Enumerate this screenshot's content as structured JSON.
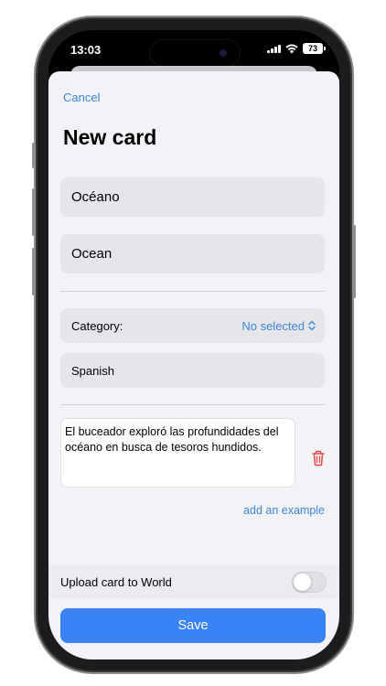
{
  "status_bar": {
    "time": "13:03",
    "battery": "73",
    "icons": [
      "cellular-signal-icon",
      "wifi-icon",
      "battery-icon"
    ]
  },
  "sheet": {
    "cancel_label": "Cancel",
    "title": "New card",
    "word_value": "Océano",
    "translation_value": "Ocean",
    "category_label": "Category:",
    "category_value": "No selected",
    "language_value": "Spanish",
    "example_text": "El buceador exploró las profundidades del océano en busca de tesoros hundidos.",
    "add_example_label": "add an example",
    "upload_label": "Upload card to World",
    "upload_enabled": false,
    "save_label": "Save"
  },
  "colors": {
    "accent": "#3a87d8",
    "save_button": "#3a82f7",
    "delete_icon": "#e5484d",
    "sheet_background": "#f2f2f7",
    "field_background": "#e5e5ea"
  }
}
